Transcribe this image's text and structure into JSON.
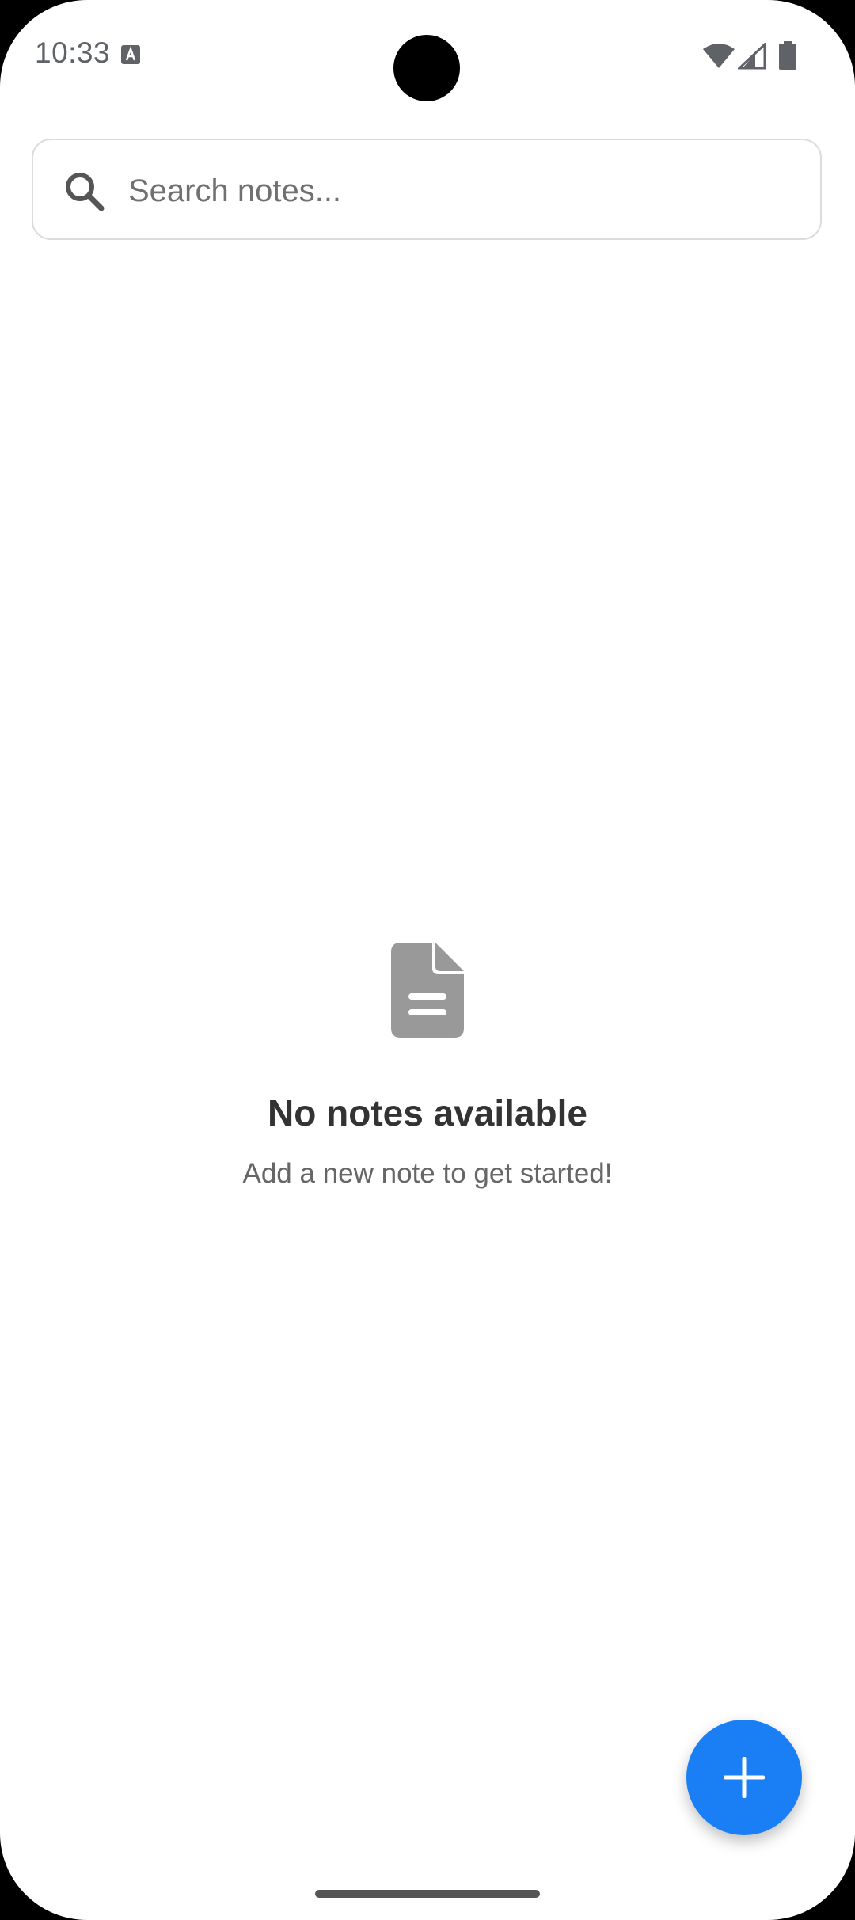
{
  "status_bar": {
    "time": "10:33",
    "notification_icon": "keyboard-a-icon",
    "wifi_icon": "wifi-icon",
    "signal_icon": "cell-signal-icon",
    "battery_icon": "battery-icon",
    "icon_color": "#5f6368"
  },
  "search": {
    "placeholder": "Search notes...",
    "value": "",
    "icon": "search-icon"
  },
  "empty_state": {
    "icon": "document-icon",
    "icon_color": "#999999",
    "title": "No notes available",
    "subtitle": "Add a new note to get started!"
  },
  "fab": {
    "icon": "plus-icon",
    "color": "#1a7ff5"
  }
}
